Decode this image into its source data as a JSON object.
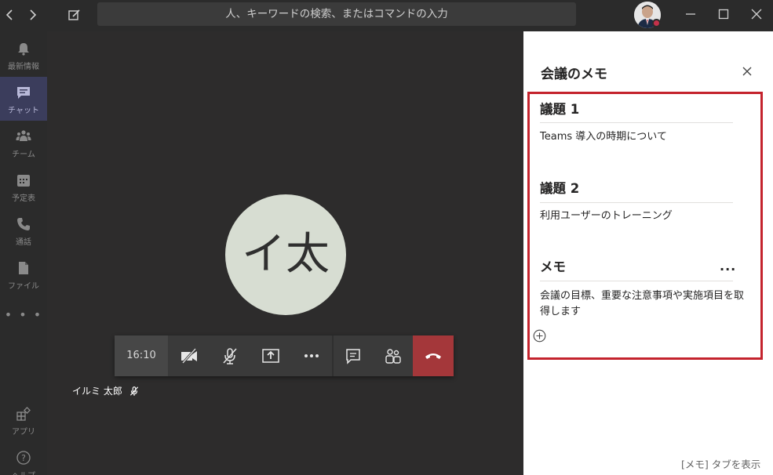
{
  "titlebar": {
    "search_placeholder": "人、キーワードの検索、またはコマンドの入力"
  },
  "rail": {
    "items": [
      {
        "label": "最新情報",
        "icon": "bell-icon"
      },
      {
        "label": "チャット",
        "icon": "chat-icon"
      },
      {
        "label": "チーム",
        "icon": "teams-icon"
      },
      {
        "label": "予定表",
        "icon": "calendar-icon"
      },
      {
        "label": "通話",
        "icon": "phone-icon"
      },
      {
        "label": "ファイル",
        "icon": "file-icon"
      }
    ],
    "more": "• • •",
    "apps_label": "アプリ",
    "help_label": "ヘルプ"
  },
  "call": {
    "avatar_initials": "イ太",
    "duration": "16:10",
    "participant_name": "イルミ 太郎",
    "hangup_color": "#a4373a"
  },
  "notes": {
    "title": "会議のメモ",
    "topics": [
      {
        "heading": "議題 1",
        "body": "Teams 導入の時期について"
      },
      {
        "heading": "議題 2",
        "body": "利用ユーザーのトレーニング"
      },
      {
        "heading": "メモ",
        "body": "会議の目標、重要な注意事項や実施項目を取得します"
      }
    ],
    "memo_more": "...",
    "footer_link": "[メモ] タブを表示",
    "highlight_color": "#c4232d"
  }
}
